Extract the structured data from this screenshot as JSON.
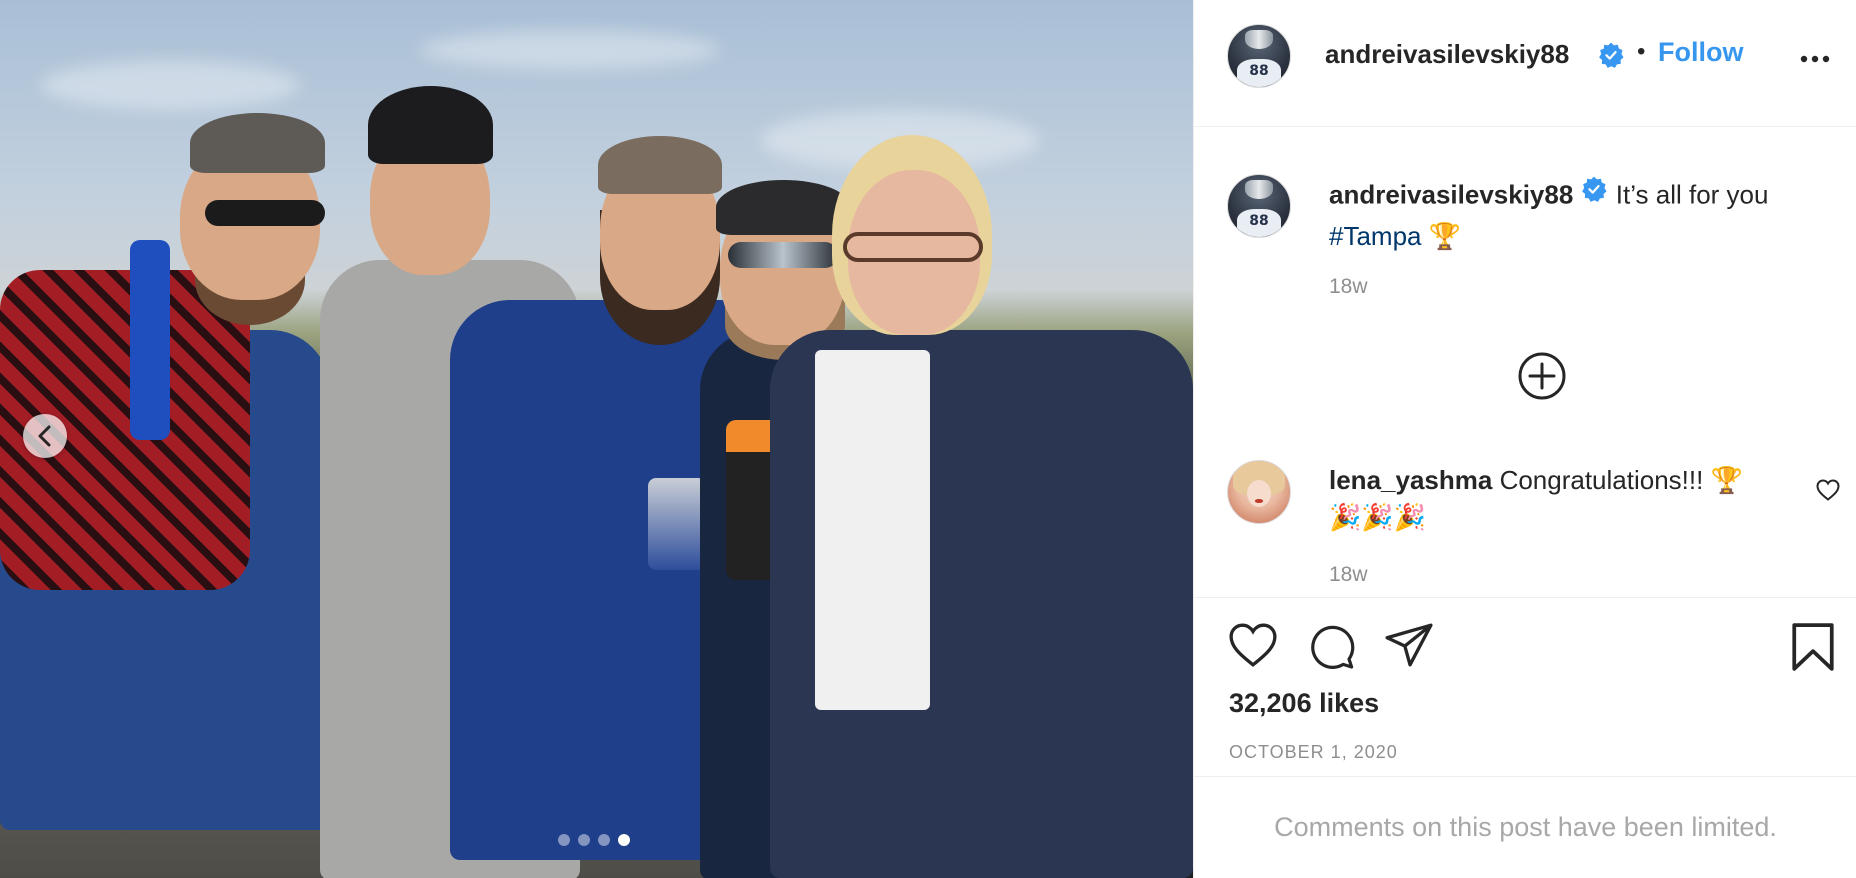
{
  "post": {
    "username": "andreivasilevskiy88",
    "verified": true,
    "separator": "•",
    "follow_label": "Follow",
    "caption": {
      "username": "andreivasilevskiy88",
      "text": "It’s all for you",
      "hashtag": "#Tampa",
      "emoji": "🏆",
      "time": "18w"
    },
    "comments": [
      {
        "username": "lena_yashma",
        "text": "Congratulations!!! 🏆",
        "emoji_line": "🎉🎉🎉",
        "time": "18w"
      }
    ],
    "likes": "32,206 likes",
    "date": "OCTOBER 1, 2020",
    "comments_limited": "Comments on this post have been limited."
  },
  "carousel": {
    "total_slides": 4,
    "active_slide": 4
  },
  "avatar_number": "88",
  "icons": {
    "verified": "verified-badge-icon",
    "more": "more-options-icon",
    "add": "load-more-comments-icon",
    "heart": "heart-icon",
    "comment": "comment-icon",
    "share": "share-icon",
    "save": "bookmark-icon",
    "prev": "chevron-left-icon"
  },
  "colors": {
    "accent": "#3797ef",
    "verified": "#3897f0",
    "hashtag": "#00376b",
    "muted": "#8e8e8e",
    "text": "#262626"
  }
}
